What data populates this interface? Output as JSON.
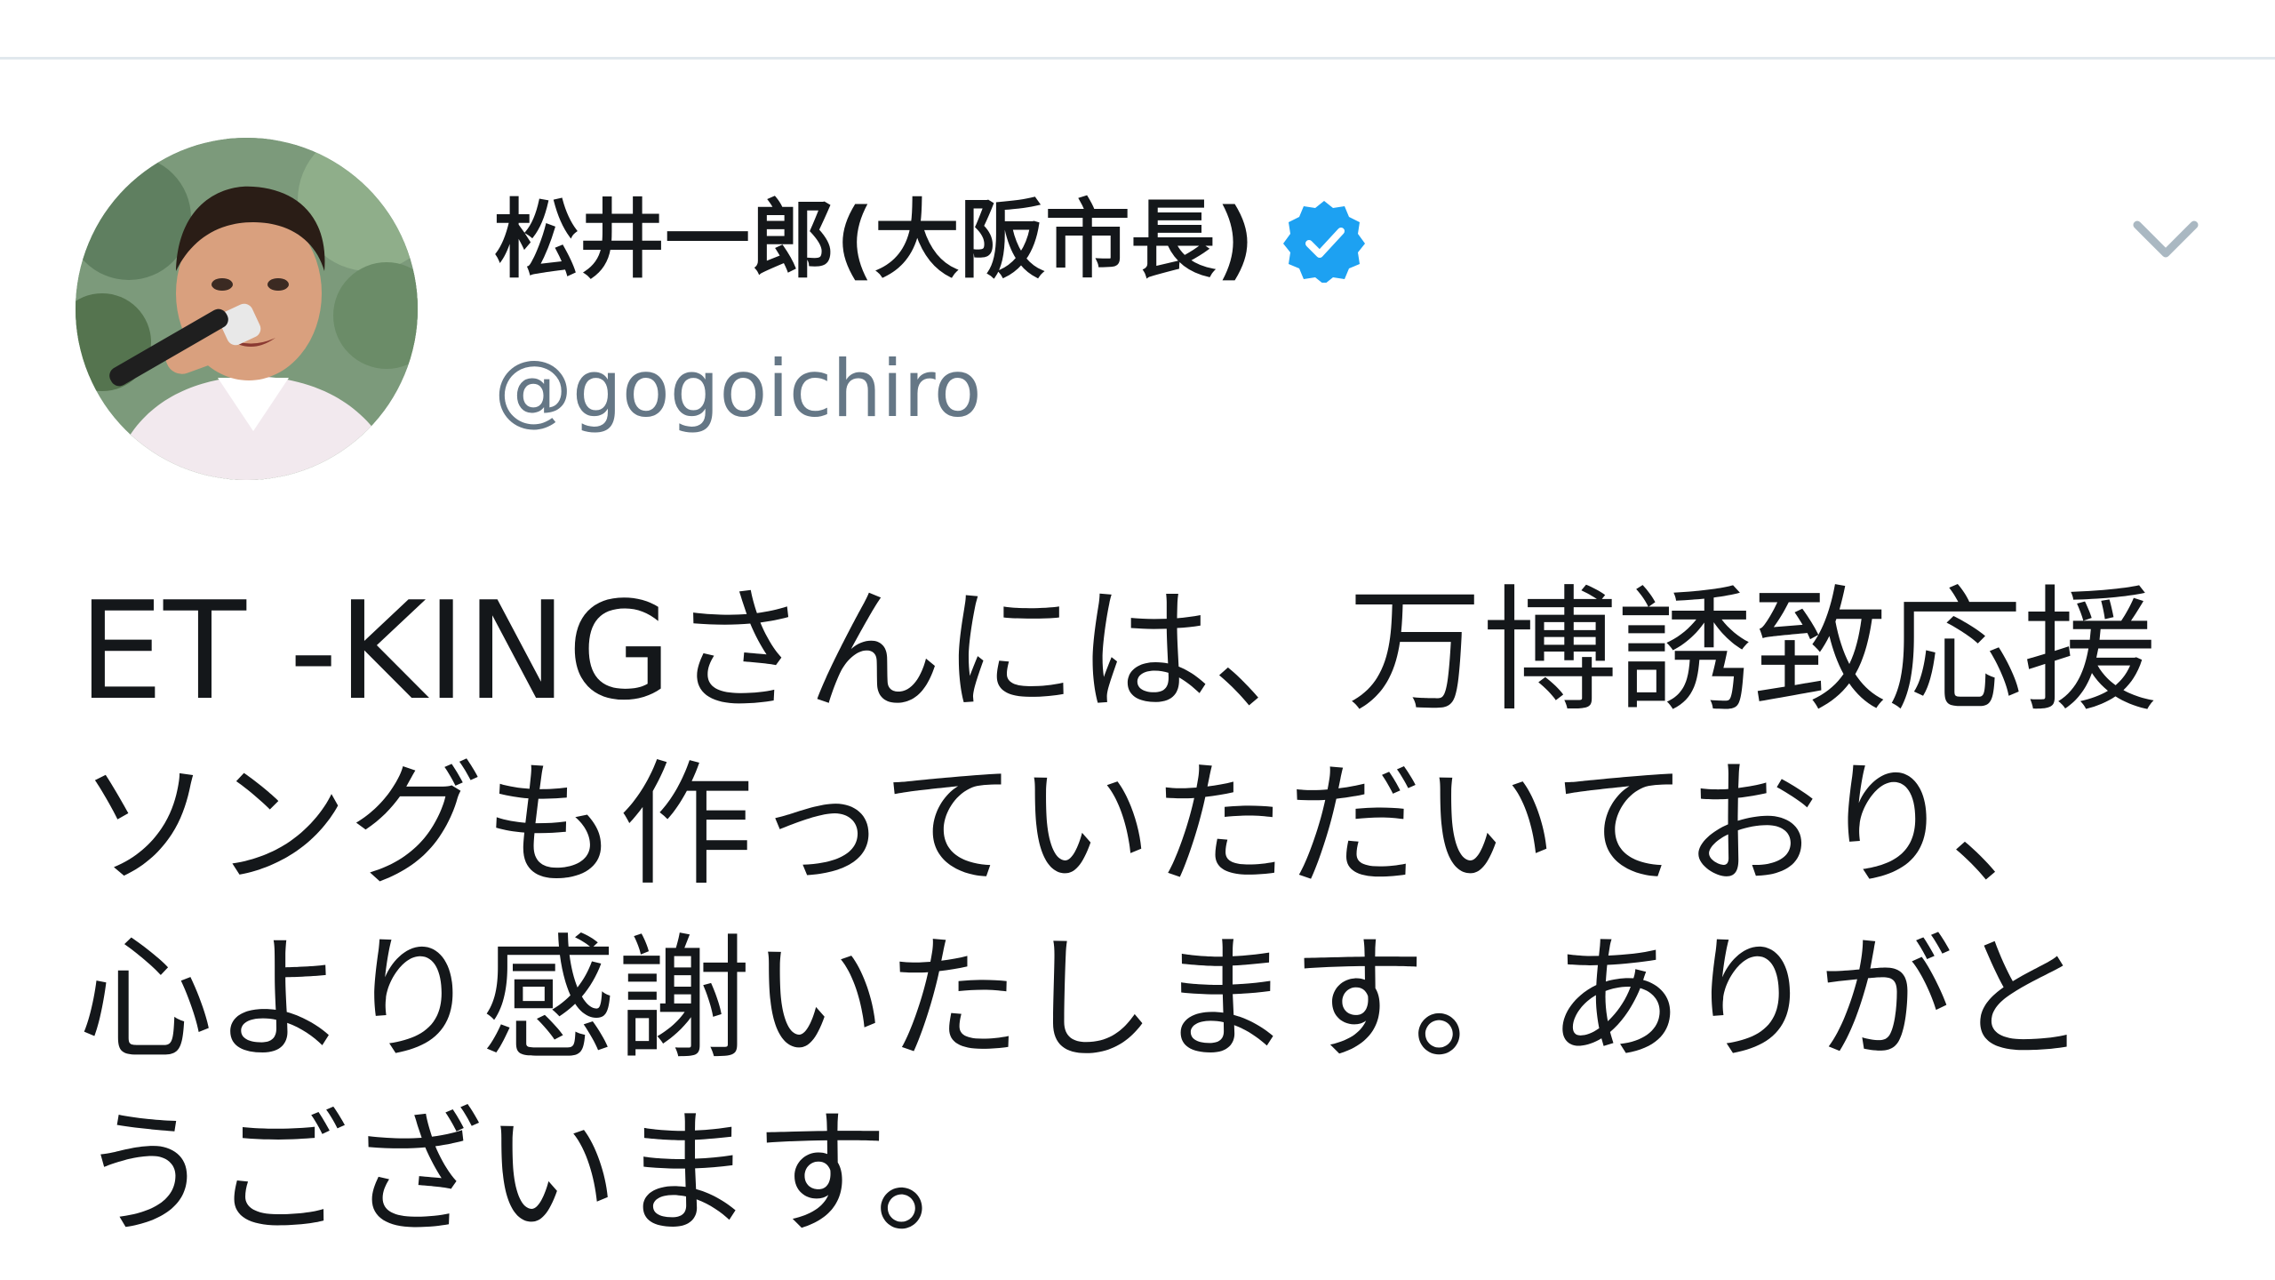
{
  "tweet": {
    "author": {
      "display_name": "松井一郎(大阪市長)",
      "handle": "@gogoichiro",
      "verified": true,
      "verified_icon": "verified-badge-icon",
      "avatar": "profile-photo"
    },
    "menu_icon": "chevron-down-icon",
    "text_lines": [
      "ET -KINGさんには、万博誘致応援",
      "ソングも作っていただいており、",
      "心より感謝いたします。ありがと",
      "うございます。"
    ]
  },
  "colors": {
    "verified_blue": "#1da1f2",
    "handle_gray": "#657786",
    "caret_gray": "#aab8c2",
    "text": "#14171a",
    "divider": "#e1e8ed"
  }
}
